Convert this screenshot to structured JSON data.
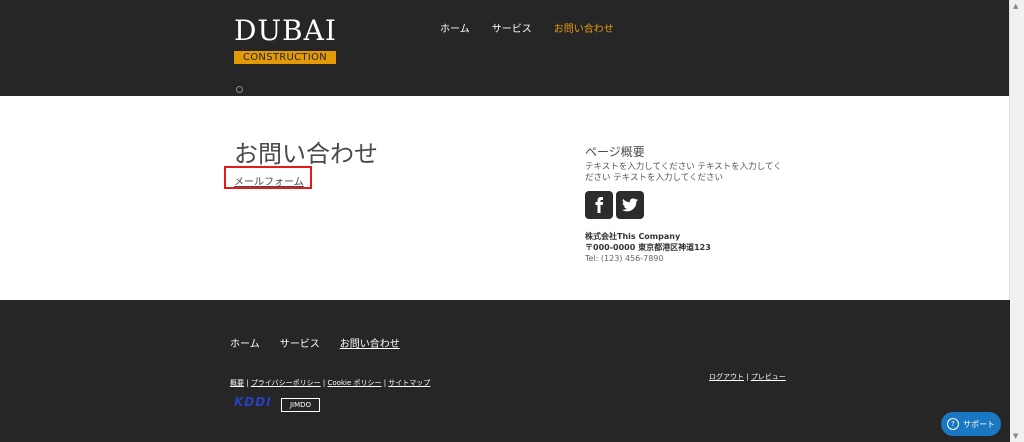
{
  "header": {
    "logo_title": "DUBAI",
    "logo_subtitle": "CONSTRUCTION",
    "nav": [
      "ホーム",
      "サービス",
      "お問い合わせ"
    ],
    "active_nav": "お問い合わせ"
  },
  "main": {
    "title": "お問い合わせ",
    "mail_link": "メールフォーム"
  },
  "sidebar": {
    "title": "ページ概要",
    "text": "テキストを入力してください テキストを入力してください テキストを入力してください",
    "company_name": "株式会社This Company",
    "address": "〒000-0000 東京都港区神道123",
    "tel": "Tel: (123) 456-7890"
  },
  "footer": {
    "nav": [
      "ホーム",
      "サービス",
      "お問い合わせ"
    ],
    "link_about": "概要",
    "link_privacy": "プライバシーポリシー",
    "link_cookie": "Cookie ポリシー",
    "link_sitemap": "サイトマップ",
    "sep": " | ",
    "link_logout": "ログアウト",
    "link_preview": "プレビュー",
    "kddi": "KDDI",
    "jimdo": "JIMDO"
  },
  "support": {
    "label": "サポート",
    "icon": "?"
  },
  "colors": {
    "accent": "#e29a09",
    "dark": "#262626",
    "highlight": "#e31b1b",
    "support": "#1a78c2"
  }
}
